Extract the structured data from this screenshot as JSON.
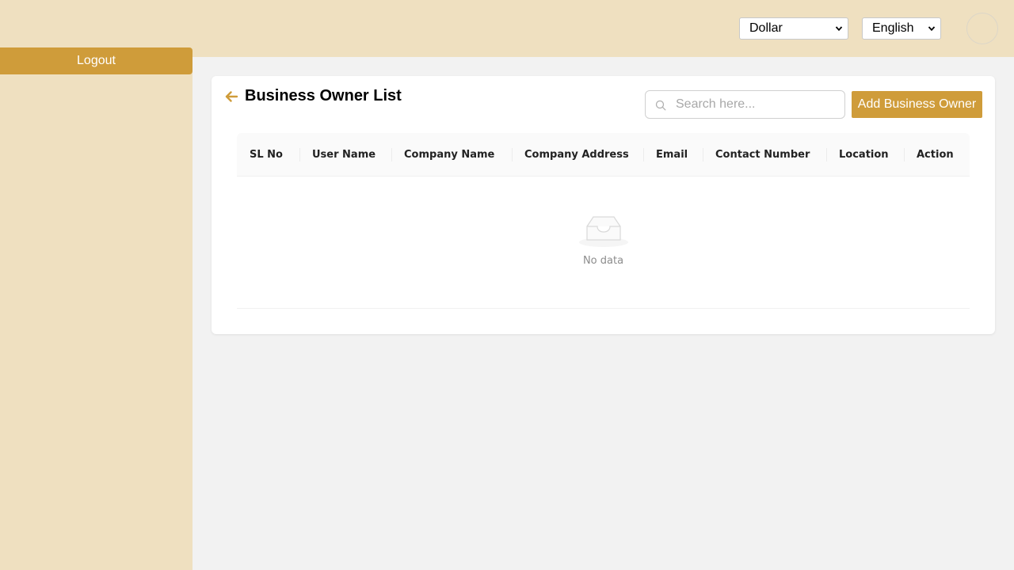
{
  "sidebar": {
    "logout_label": "Logout"
  },
  "header": {
    "currency": {
      "selected": "Dollar"
    },
    "language": {
      "selected": "English"
    }
  },
  "page": {
    "title": "Business Owner List",
    "search_placeholder": "Search here...",
    "add_button_label": "Add Business Owner"
  },
  "table": {
    "columns": [
      "SL No",
      "User Name",
      "Company Name",
      "Company Address",
      "Email",
      "Contact Number",
      "Location",
      "Action"
    ],
    "rows": [],
    "empty_text": "No data"
  },
  "colors": {
    "accent": "#cf9c3a",
    "panel_bg": "#efe0c0",
    "page_bg": "#f2f2f2"
  },
  "icons": [
    "back-arrow-icon",
    "search-icon",
    "chevron-down-icon",
    "empty-inbox-icon"
  ]
}
